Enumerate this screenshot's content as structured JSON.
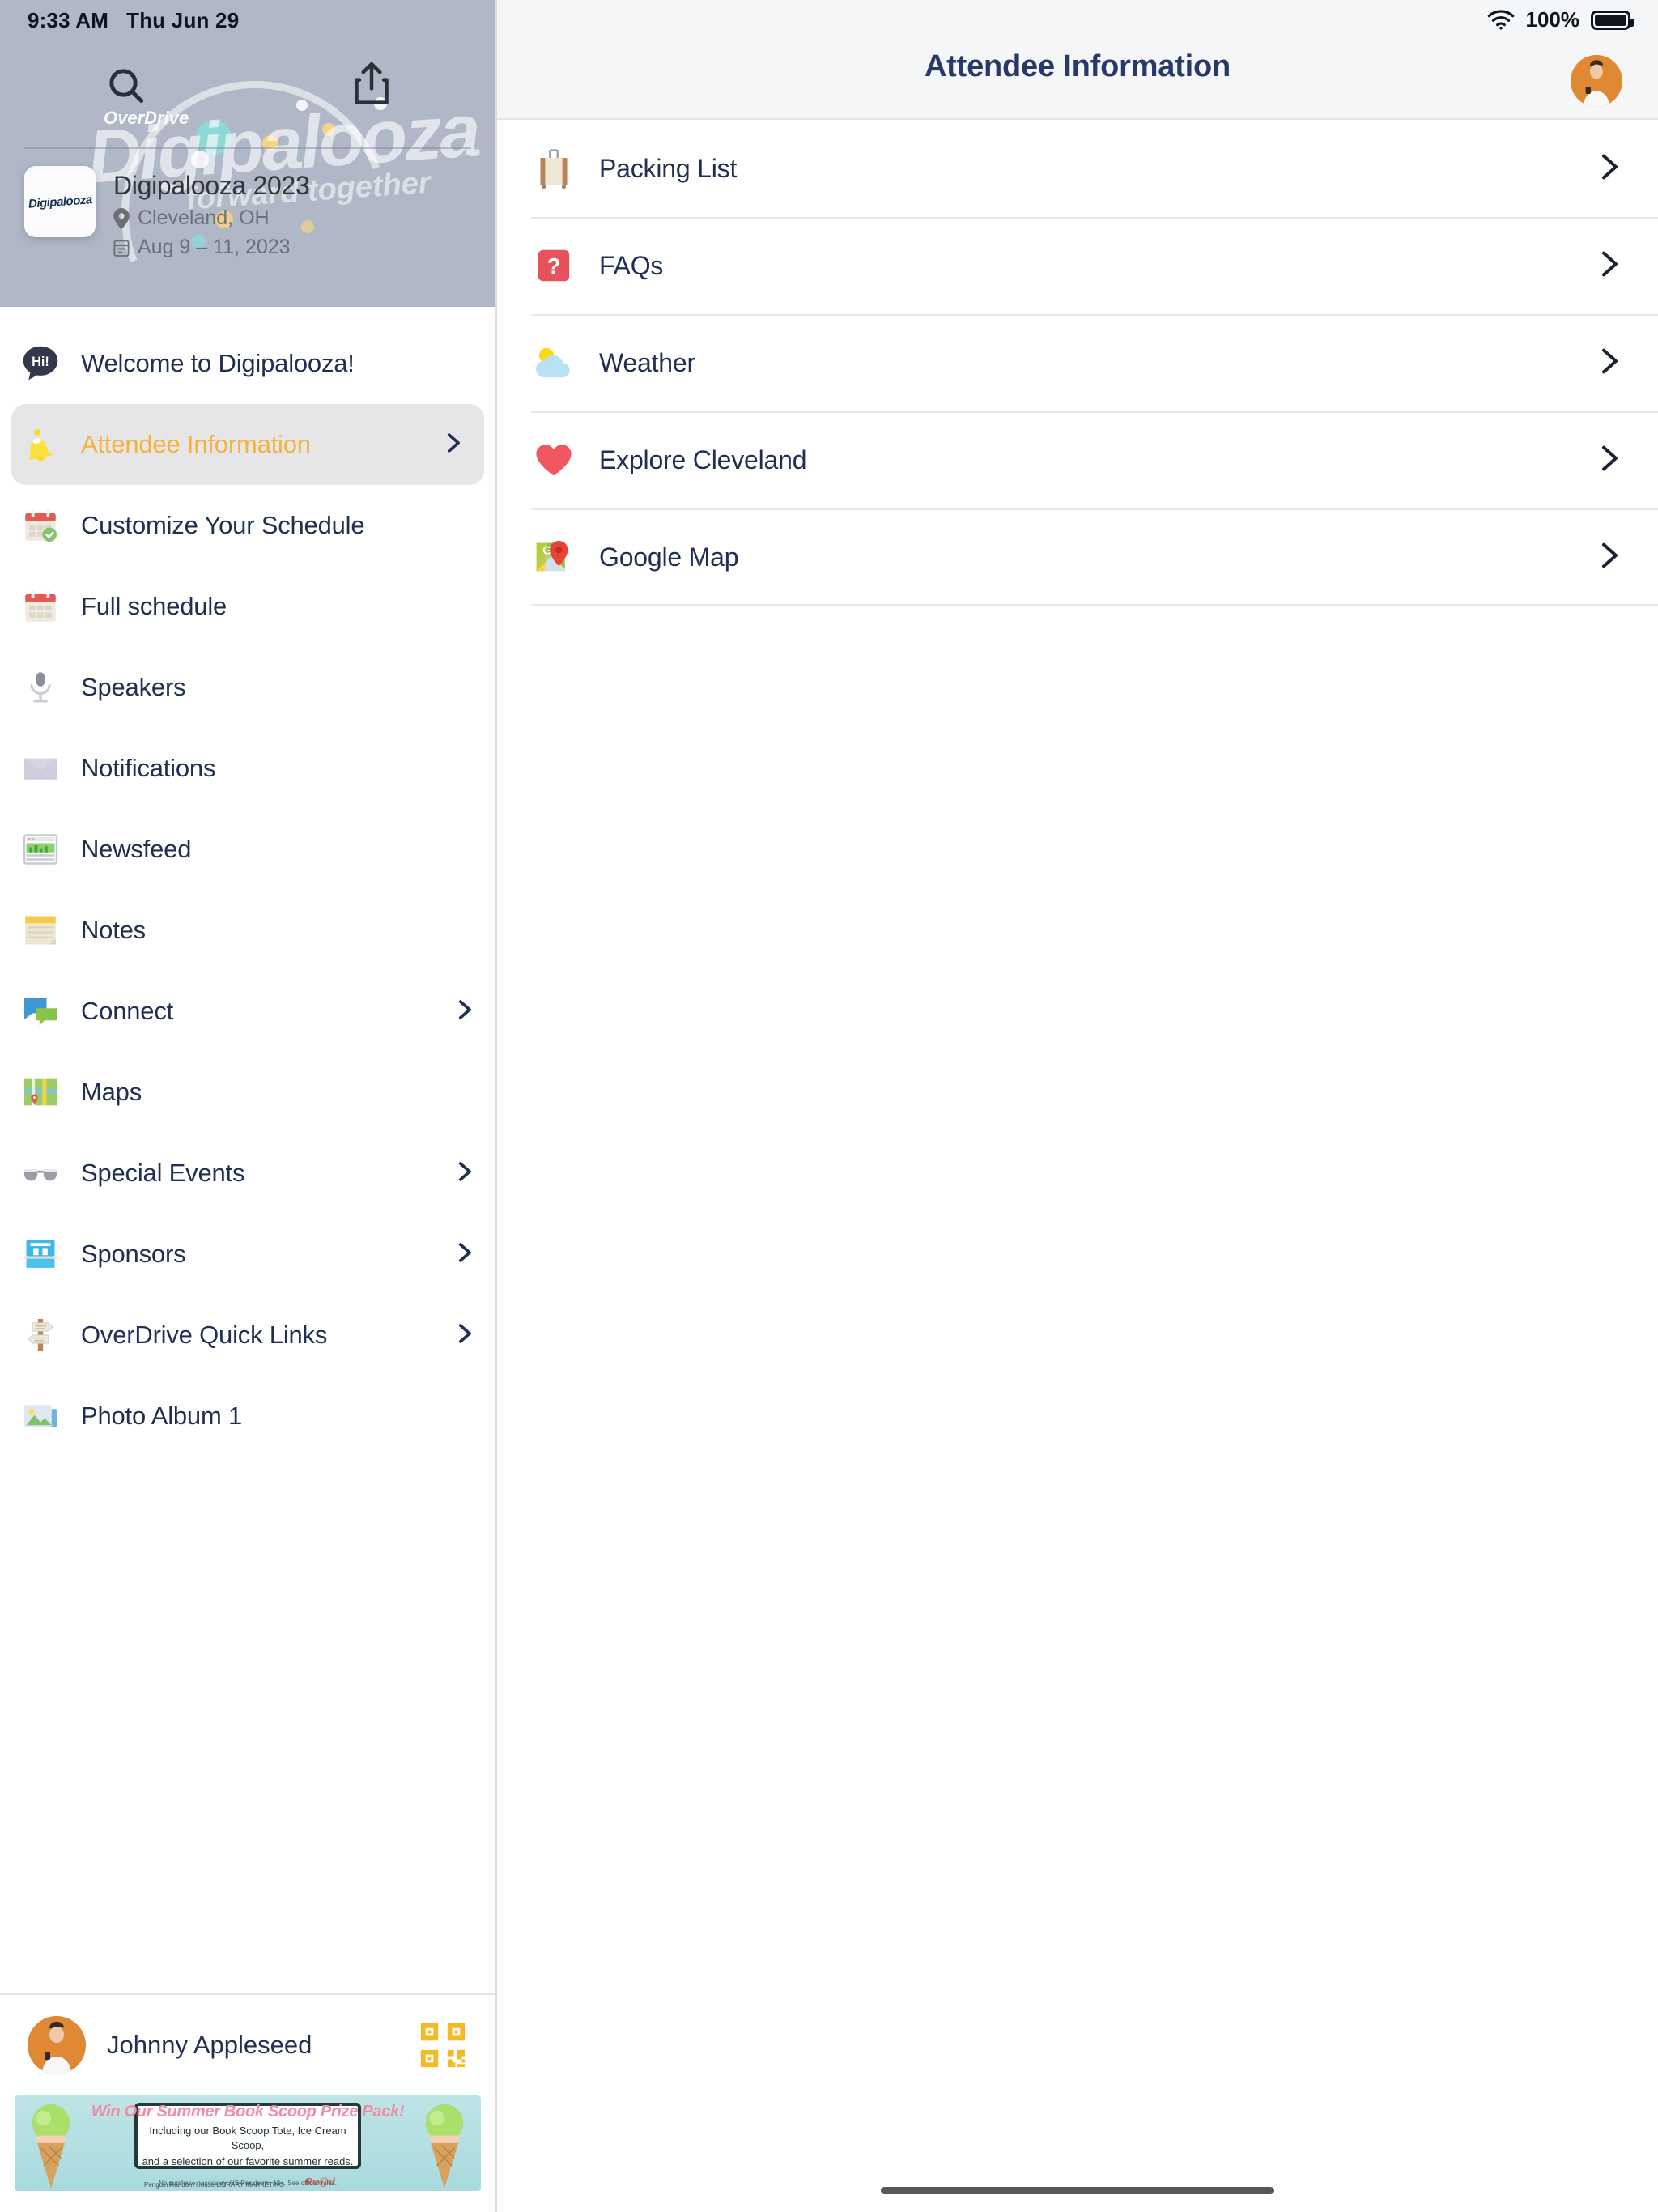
{
  "status_bar": {
    "time": "9:33 AM",
    "date": "Thu Jun 29",
    "battery_percent": "100%",
    "wifi_icon": "wifi-icon",
    "battery_icon": "battery-full-icon"
  },
  "sidebar": {
    "search_icon": "search-icon",
    "share_icon": "share-icon",
    "overdrive_label": "OverDrive",
    "hero_wordmark": "Digipalooza",
    "hero_tagline": "forward together",
    "event": {
      "logo_text": "Digipalooza",
      "title": "Digipalooza 2023",
      "location": "Cleveland, OH",
      "location_icon": "map-pin-icon",
      "dates": "Aug 9 – 11, 2023",
      "date_icon": "calendar-icon"
    },
    "items": [
      {
        "label": "Welcome to Digipalooza!",
        "icon": "speech-bubble-hi-icon",
        "chevron": false,
        "selected": false
      },
      {
        "label": "Attendee Information",
        "icon": "bell-icon",
        "chevron": true,
        "selected": true
      },
      {
        "label": "Customize Your Schedule",
        "icon": "calendar-check-icon",
        "chevron": false,
        "selected": false
      },
      {
        "label": "Full schedule",
        "icon": "calendar-icon",
        "chevron": false,
        "selected": false
      },
      {
        "label": "Speakers",
        "icon": "microphone-icon",
        "chevron": false,
        "selected": false
      },
      {
        "label": "Notifications",
        "icon": "envelope-icon",
        "chevron": false,
        "selected": false
      },
      {
        "label": "Newsfeed",
        "icon": "newspaper-icon",
        "chevron": false,
        "selected": false
      },
      {
        "label": "Notes",
        "icon": "notepad-icon",
        "chevron": false,
        "selected": false
      },
      {
        "label": "Connect",
        "icon": "chat-bubbles-icon",
        "chevron": true,
        "selected": false
      },
      {
        "label": "Maps",
        "icon": "map-icon",
        "chevron": false,
        "selected": false
      },
      {
        "label": "Special Events",
        "icon": "sunglasses-icon",
        "chevron": true,
        "selected": false
      },
      {
        "label": "Sponsors",
        "icon": "exhibit-booth-icon",
        "chevron": true,
        "selected": false
      },
      {
        "label": "OverDrive Quick Links",
        "icon": "signpost-icon",
        "chevron": true,
        "selected": false
      },
      {
        "label": "Photo Album 1",
        "icon": "photo-icon",
        "chevron": false,
        "selected": false
      }
    ],
    "footer": {
      "user_name": "Johnny Appleseed",
      "avatar_icon": "user-avatar",
      "qr_icon": "qr-code-icon"
    },
    "ad": {
      "headline": "Win Our Summer Book Scoop Prize Pack!",
      "subline_1": "Including our Book Scoop Tote, Ice Cream Scoop,",
      "subline_2": "and a selection of our favorite summer reads.",
      "legal": "No purchase necessary. US Residents, 18+. See official rules.",
      "brand": "Penguin Random House LIBRARY MARKETING",
      "read_mark": "Re@d",
      "left_icon": "ice-cream-cone-icon",
      "right_icon": "ice-cream-cone-icon"
    }
  },
  "main": {
    "title": "Attendee Information",
    "avatar_icon": "user-avatar",
    "rows": [
      {
        "label": "Packing List",
        "icon": "suitcase-icon",
        "chevron_icon": "chevron-right-icon"
      },
      {
        "label": "FAQs",
        "icon": "question-mark-icon",
        "chevron_icon": "chevron-right-icon"
      },
      {
        "label": "Weather",
        "icon": "sun-cloud-icon",
        "chevron_icon": "chevron-right-icon"
      },
      {
        "label": "Explore Cleveland",
        "icon": "heart-icon",
        "chevron_icon": "chevron-right-icon"
      },
      {
        "label": "Google Map",
        "icon": "google-maps-pin-icon",
        "chevron_icon": "chevron-right-icon"
      }
    ]
  },
  "colors": {
    "accent_yellow": "#f3b33c",
    "text_navy": "#1f2f52",
    "title_navy": "#29386b",
    "hero_bg": "#b0b8c8",
    "selected_bg": "#e6e6e8",
    "avatar_orange": "#e08935"
  }
}
